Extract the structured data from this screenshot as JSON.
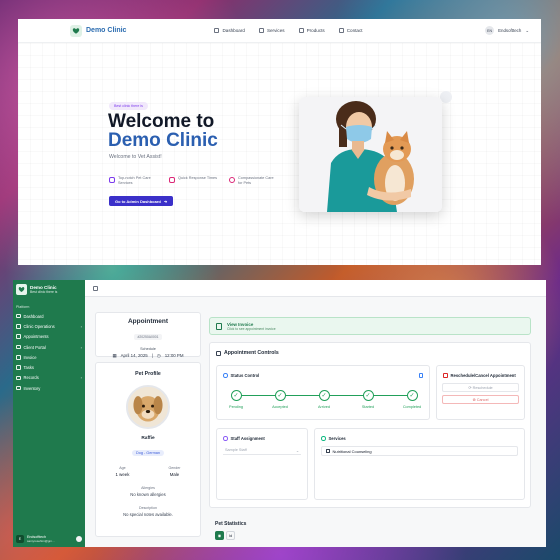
{
  "landing": {
    "brand": "Demo Clinic",
    "nav": [
      {
        "label": "Dashboard",
        "icon": "dashboard-icon"
      },
      {
        "label": "Services",
        "icon": "services-icon"
      },
      {
        "label": "Products",
        "icon": "products-icon"
      },
      {
        "label": "Contact",
        "icon": "contact-icon"
      }
    ],
    "user": {
      "initials": "EN",
      "name": "Endsofttech"
    },
    "badge": "Best clinic there is",
    "title_line1": "Welcome to",
    "title_line2": "Demo Clinic",
    "subtitle": "Welcome to Vet Assist!",
    "features": [
      {
        "text": "Top-notch Pet Care Services",
        "color": "#7c3aed"
      },
      {
        "text": "Quick Response Times",
        "color": "#db2777"
      },
      {
        "text": "Compassionate Care for Pets",
        "color": "#db2777"
      }
    ],
    "cta": "Go to Admin Dashboard",
    "cta_arrow": "➔"
  },
  "sidebar": {
    "brand": "Demo Clinic",
    "tagline": "Best clinic there is",
    "section": "Platform",
    "items": [
      {
        "label": "Dashboard",
        "chevron": ""
      },
      {
        "label": "Clinic Operations",
        "chevron": "›"
      },
      {
        "label": "Appointments",
        "chevron": ""
      },
      {
        "label": "Client Portal",
        "chevron": "›"
      },
      {
        "label": "Invoice",
        "chevron": ""
      },
      {
        "label": "Tasks",
        "chevron": ""
      },
      {
        "label": "Records",
        "chevron": "›"
      },
      {
        "label": "Inventory",
        "chevron": ""
      }
    ],
    "user": {
      "initial": "E",
      "name": "Endsofttech",
      "email": "samyrosehim@gm..."
    }
  },
  "appointment": {
    "title": "Appointment",
    "id": "#20250A0001",
    "schedule_label": "Schedule",
    "date": "April 14, 2025",
    "time": "12:00 PM"
  },
  "pet": {
    "title": "Pet Profile",
    "name": "Raffie",
    "breed": "Dog - German",
    "age_label": "Age",
    "age": "1 week",
    "gender_label": "Gender",
    "gender": "Male",
    "allergies_label": "Allergies",
    "allergies": "No known allergies",
    "description_label": "Description",
    "description": "No special notes available."
  },
  "invoice": {
    "title": "View Invoice",
    "subtitle": "Click to see appointment invoice"
  },
  "controls": {
    "title": "Appointment Controls",
    "status_title": "Status Control",
    "steps": [
      "Pending",
      "Accepted",
      "Arrived",
      "Started",
      "Completed"
    ],
    "check": "✓",
    "resched_title": "Reschedule/Cancel Appointment",
    "reschedule": "Reschedule",
    "cancel": "Cancel",
    "staff_title": "Staff Assignment",
    "staff_placeholder": "Sample Staff",
    "staff_chevron": "⌄",
    "services_title": "Services",
    "services": [
      "Nutritional Counseling"
    ]
  },
  "stats": {
    "title": "Pet Statistics",
    "tab_icon": "Id"
  }
}
